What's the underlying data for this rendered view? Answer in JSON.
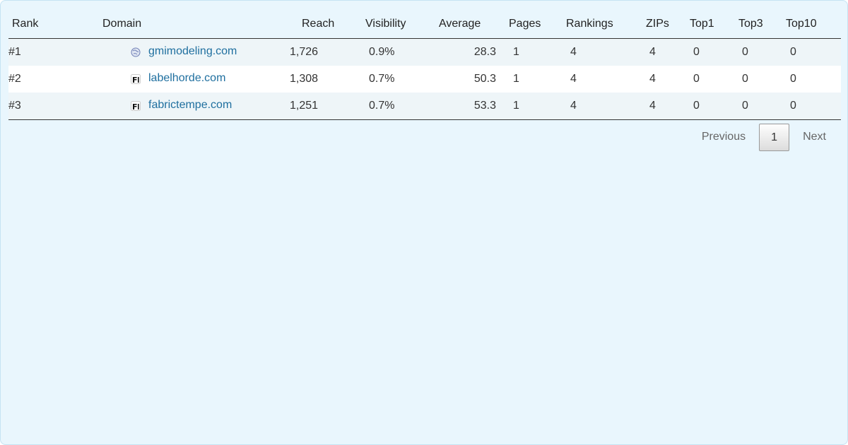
{
  "table": {
    "headers": {
      "rank": "Rank",
      "domain": "Domain",
      "reach": "Reach",
      "visibility": "Visibility",
      "average": "Average",
      "pages": "Pages",
      "rankings": "Rankings",
      "zips": "ZIPs",
      "top1": "Top1",
      "top3": "Top3",
      "top10": "Top10"
    },
    "rows": [
      {
        "rank": "#1",
        "favicon": "globe-icon",
        "domain": "gmimodeling.com",
        "reach": "1,726",
        "visibility": "0.9%",
        "average": "28.3",
        "pages": "1",
        "rankings": "4",
        "zips": "4",
        "top1": "0",
        "top3": "0",
        "top10": "0"
      },
      {
        "rank": "#2",
        "favicon": "fi-favicon-icon",
        "domain": "labelhorde.com",
        "reach": "1,308",
        "visibility": "0.7%",
        "average": "50.3",
        "pages": "1",
        "rankings": "4",
        "zips": "4",
        "top1": "0",
        "top3": "0",
        "top10": "0"
      },
      {
        "rank": "#3",
        "favicon": "fi-favicon-icon",
        "domain": "fabrictempe.com",
        "reach": "1,251",
        "visibility": "0.7%",
        "average": "53.3",
        "pages": "1",
        "rankings": "4",
        "zips": "4",
        "top1": "0",
        "top3": "0",
        "top10": "0"
      }
    ]
  },
  "pagination": {
    "previous_label": "Previous",
    "current_page": "1",
    "next_label": "Next"
  },
  "colors": {
    "panel_bg": "#e9f6fd",
    "link": "#1f6f9f",
    "row_alt": "#eef5f8"
  }
}
